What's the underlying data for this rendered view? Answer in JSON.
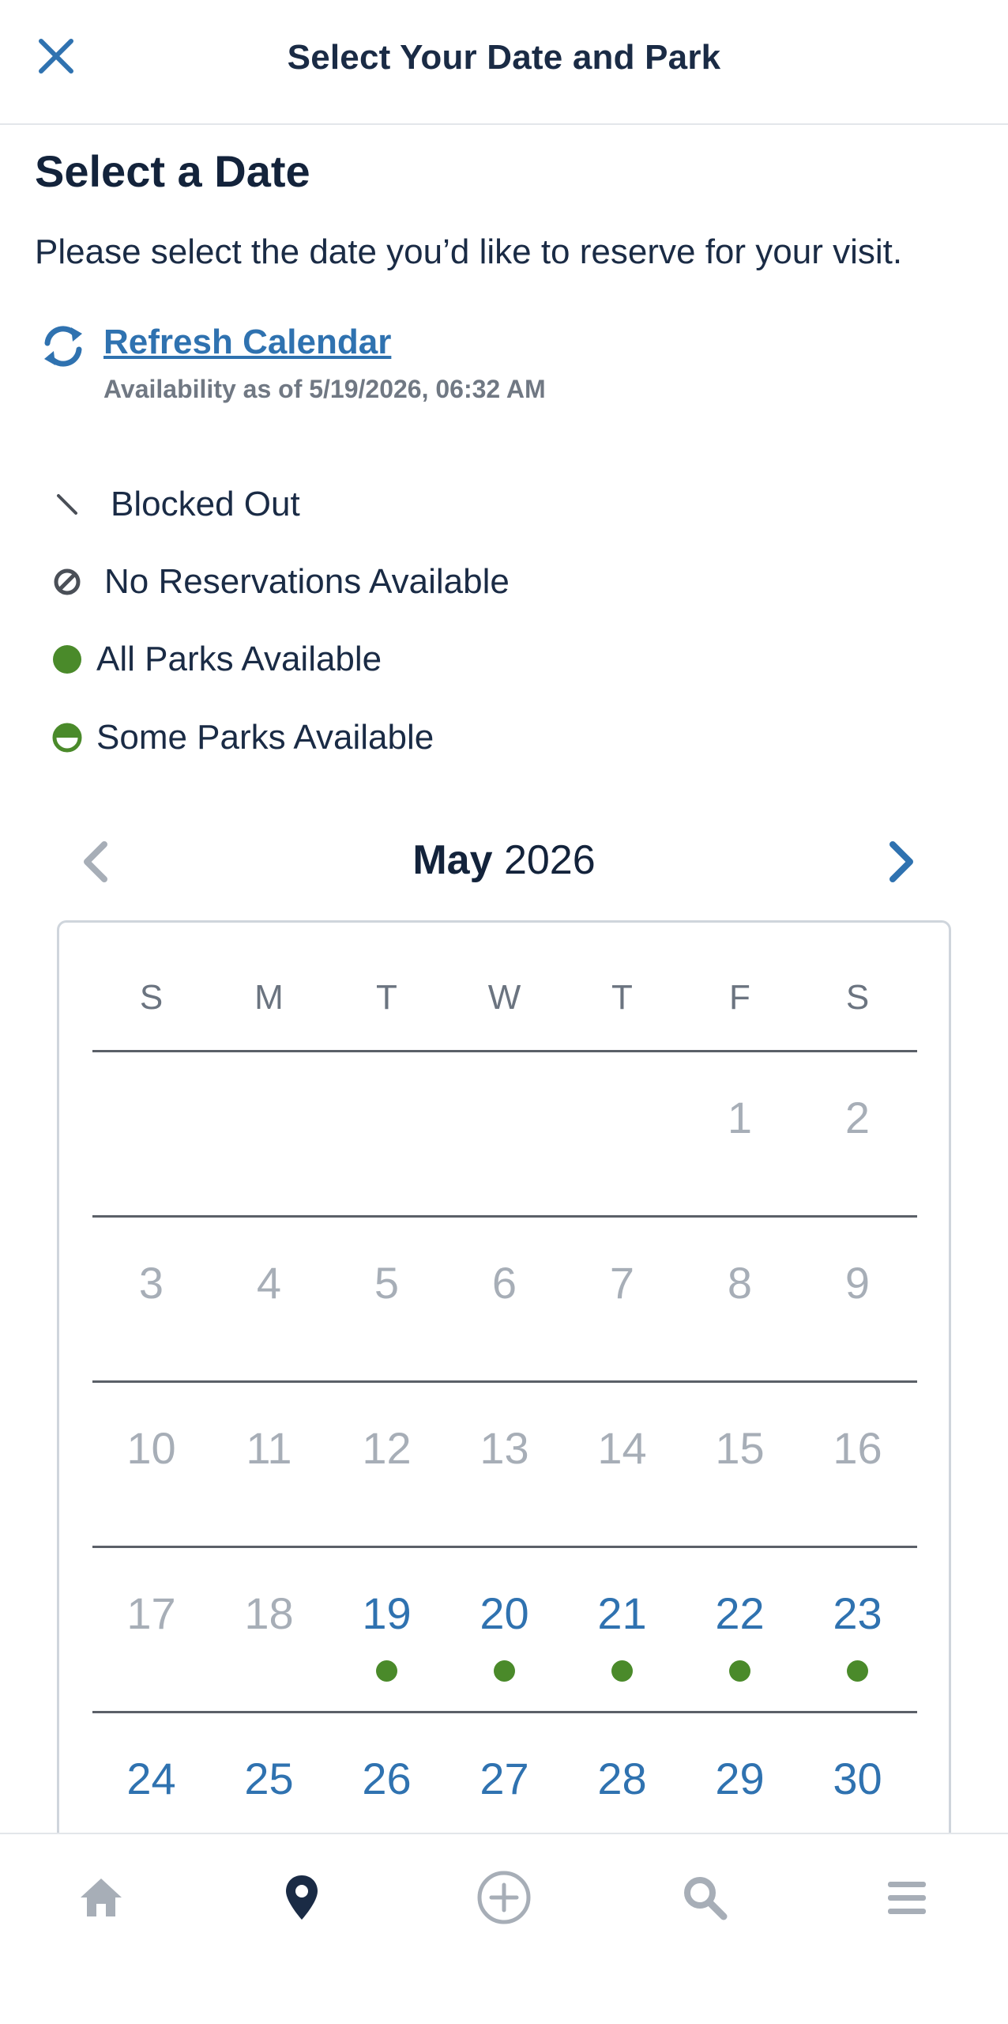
{
  "header": {
    "title": "Select Your Date and Park",
    "close_icon": "close-icon"
  },
  "section": {
    "title": "Select a Date",
    "instructions": "Please select the date you’d like to reserve for your visit."
  },
  "refresh": {
    "link_label": "Refresh Calendar",
    "availability": "Availability as of 5/19/2026, 06:32 AM"
  },
  "legend": [
    {
      "icon": "blocked-out-icon",
      "label": "Blocked Out"
    },
    {
      "icon": "no-reservations-icon",
      "label": "No Reservations Available"
    },
    {
      "icon": "all-parks-icon",
      "label": "All Parks Available"
    },
    {
      "icon": "some-parks-icon",
      "label": "Some Parks Available"
    }
  ],
  "calendar": {
    "month": "May",
    "year": "2026",
    "weekdays": [
      "S",
      "M",
      "T",
      "W",
      "T",
      "F",
      "S"
    ],
    "weeks": [
      [
        "",
        "",
        "",
        "",
        "",
        "1",
        "2"
      ],
      [
        "3",
        "4",
        "5",
        "6",
        "7",
        "8",
        "9"
      ],
      [
        "10",
        "11",
        "12",
        "13",
        "14",
        "15",
        "16"
      ],
      [
        "17",
        "18",
        "19",
        "20",
        "21",
        "22",
        "23"
      ],
      [
        "24",
        "25",
        "26",
        "27",
        "28",
        "29",
        "30"
      ]
    ],
    "available_days": [
      "19",
      "20",
      "21",
      "22",
      "23",
      "24",
      "25",
      "26",
      "27",
      "28",
      "29",
      "30"
    ],
    "all_parks_days": [
      "19",
      "20",
      "21",
      "22",
      "23"
    ]
  },
  "colors": {
    "accent": "#2f72b0",
    "available_dot": "#4a8a2a",
    "disabled_text": "#a7aeb7",
    "title_text": "#13233b"
  },
  "bottom_nav": [
    {
      "icon": "home-icon"
    },
    {
      "icon": "location-pin-icon",
      "active": true
    },
    {
      "icon": "add-circle-icon"
    },
    {
      "icon": "search-icon"
    },
    {
      "icon": "menu-icon"
    }
  ]
}
